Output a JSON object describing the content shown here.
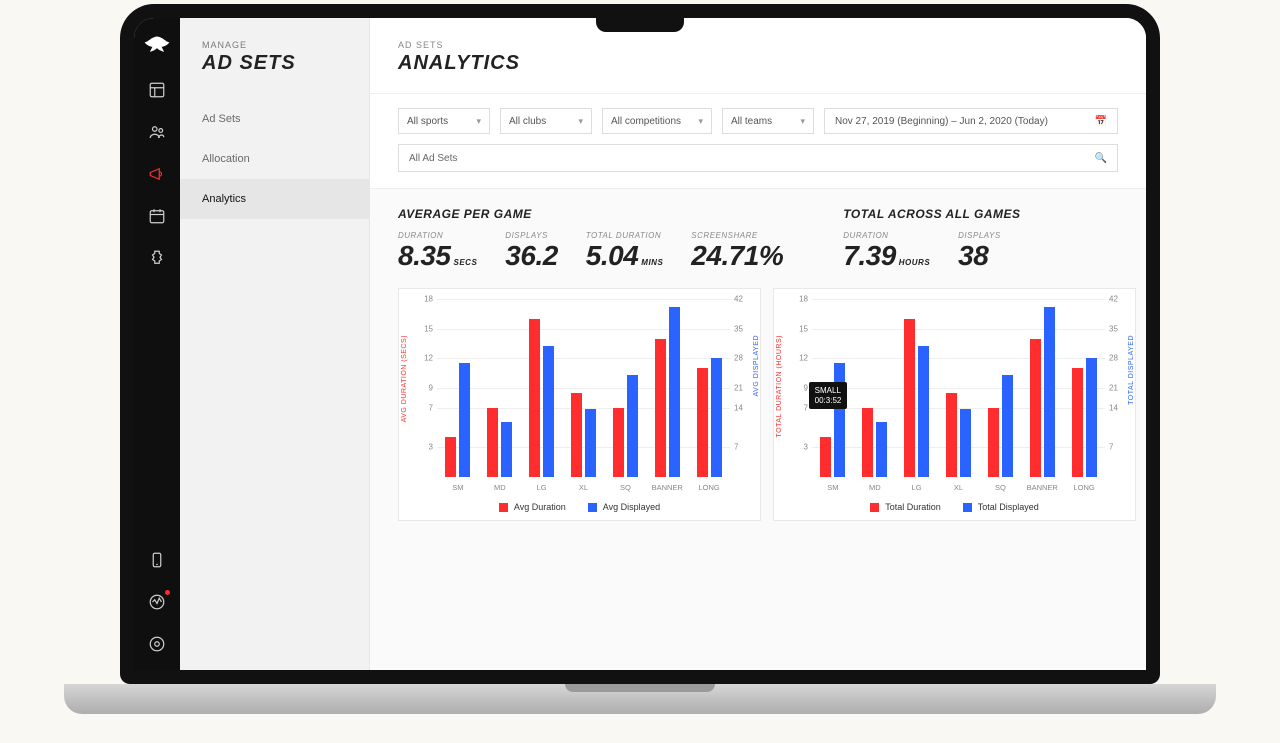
{
  "sidebar_section": {
    "eyebrow": "MANAGE",
    "title": "AD SETS"
  },
  "subnav": [
    "Ad Sets",
    "Allocation",
    "Analytics"
  ],
  "subnav_active": 2,
  "page": {
    "eyebrow": "AD SETS",
    "title": "ANALYTICS"
  },
  "filters": {
    "sports": "All sports",
    "clubs": "All clubs",
    "competitions": "All competitions",
    "teams": "All teams",
    "daterange": "Nov 27, 2019 (Beginning) – Jun 2, 2020 (Today)",
    "search": "All Ad Sets"
  },
  "stats": {
    "avg_title": "AVERAGE PER GAME",
    "total_title": "TOTAL ACROSS ALL GAMES",
    "avg": [
      {
        "label": "DURATION",
        "value": "8.35",
        "unit": "SECS"
      },
      {
        "label": "DISPLAYS",
        "value": "36.2",
        "unit": ""
      },
      {
        "label": "TOTAL DURATION",
        "value": "5.04",
        "unit": "MINS"
      },
      {
        "label": "SCREENSHARE",
        "value": "24.71%",
        "unit": ""
      }
    ],
    "total": [
      {
        "label": "DURATION",
        "value": "7.39",
        "unit": "HOURS"
      },
      {
        "label": "DISPLAYS",
        "value": "38",
        "unit": ""
      }
    ]
  },
  "chart_data": [
    {
      "type": "bar",
      "title": "",
      "categories": [
        "SM",
        "MD",
        "LG",
        "XL",
        "SQ",
        "BANNER",
        "LONG"
      ],
      "series": [
        {
          "name": "Avg Duration",
          "color": "#ff2d2d",
          "axis": "left",
          "values": [
            4,
            7,
            16,
            8.5,
            7,
            14,
            11
          ]
        },
        {
          "name": "Avg Displayed",
          "color": "#2a63ff",
          "axis": "right",
          "values": [
            27,
            13,
            31,
            16,
            24,
            40,
            28
          ]
        }
      ],
      "left_axis": {
        "label": "AVG DURATION (SECS)",
        "ticks": [
          3,
          7,
          9,
          12,
          15,
          18
        ],
        "min": 0,
        "max": 18
      },
      "right_axis": {
        "label": "AVG DISPLAYED",
        "ticks": [
          7,
          14,
          21,
          28,
          35,
          42
        ],
        "min": 0,
        "max": 42
      }
    },
    {
      "type": "bar",
      "title": "",
      "categories": [
        "SM",
        "MD",
        "LG",
        "XL",
        "SQ",
        "BANNER",
        "LONG"
      ],
      "series": [
        {
          "name": "Total Duration",
          "color": "#ff2d2d",
          "axis": "left",
          "values": [
            4,
            7,
            16,
            8.5,
            7,
            14,
            11
          ]
        },
        {
          "name": "Total Displayed",
          "color": "#2a63ff",
          "axis": "right",
          "values": [
            27,
            13,
            31,
            16,
            24,
            40,
            28
          ]
        }
      ],
      "left_axis": {
        "label": "TOTAL DURATION (HOURS)",
        "ticks": [
          3,
          7,
          9,
          12,
          15,
          18
        ],
        "min": 0,
        "max": 18
      },
      "right_axis": {
        "label": "TOTAL DISPLAYED",
        "ticks": [
          7,
          14,
          21,
          28,
          35,
          42
        ],
        "min": 0,
        "max": 42
      },
      "tooltip": {
        "category": "SM",
        "lines": [
          "SMALL",
          "00:3:52"
        ]
      }
    }
  ]
}
